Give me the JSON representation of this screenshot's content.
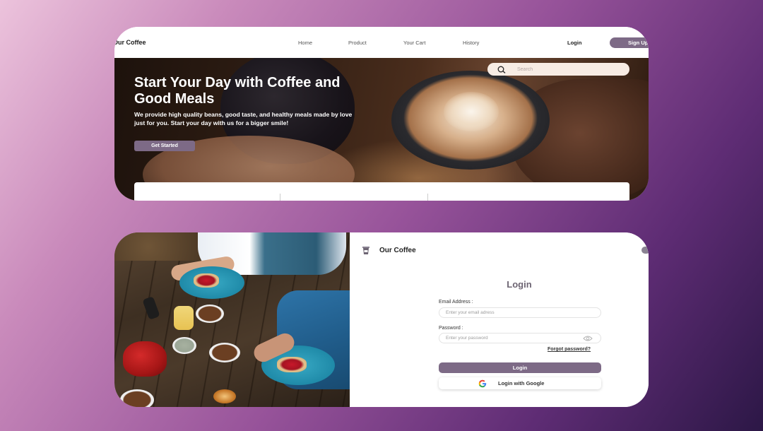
{
  "landing": {
    "brand": "Our Coffee",
    "nav": {
      "links": [
        "Home",
        "Product",
        "Your Cart",
        "History"
      ],
      "login": "Login",
      "signup": "Sign Up"
    },
    "search": {
      "placeholder": "Search"
    },
    "hero": {
      "title": "Start Your Day with Coffee and Good Meals",
      "description": "We provide high quality beans, good taste, and healthy meals made by love just for you. Start your day with us for a bigger smile!",
      "cta": "Get Started"
    }
  },
  "login_page": {
    "brand": "Our Coffee",
    "title": "Login",
    "email": {
      "label": "Email Address :",
      "placeholder": "Enter your email adress"
    },
    "password": {
      "label": "Password :",
      "placeholder": "Enter your password"
    },
    "forgot": "Forgot password?",
    "login_button": "Login",
    "google_button": "Login with Google"
  },
  "colors": {
    "accent": "#7d6a86",
    "title_text": "#6d6573"
  },
  "icons": [
    "search-icon",
    "eye-icon",
    "google-icon",
    "coffee-cup-logo-icon"
  ]
}
